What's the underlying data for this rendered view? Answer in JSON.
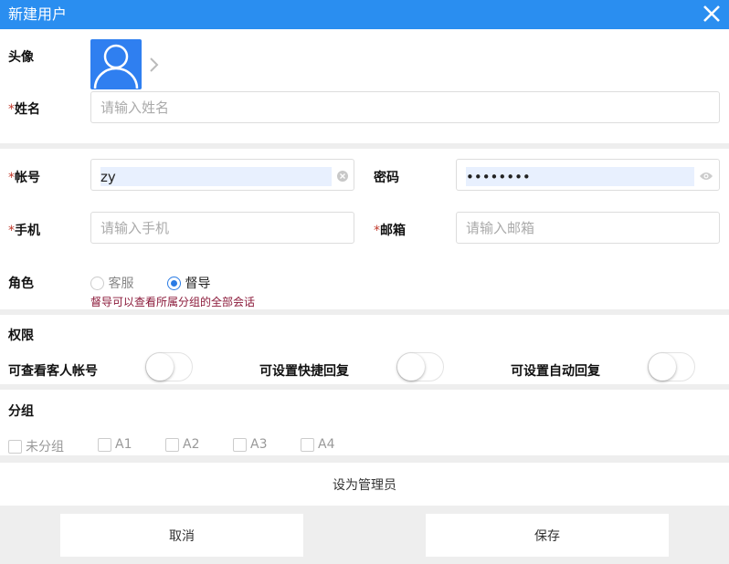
{
  "dialog": {
    "title": "新建用户",
    "close_icon": "close-icon"
  },
  "colors": {
    "header": "#2a8ef0",
    "required": "#c0392b",
    "hint": "#8b1a3a",
    "radio_active": "#2a7be4"
  },
  "form": {
    "avatar": {
      "label": "头像",
      "icon": "user-icon"
    },
    "name": {
      "required": "*",
      "label": "姓名",
      "placeholder": "请输入姓名",
      "value": ""
    },
    "account": {
      "required": "*",
      "label": "帐号",
      "value": "zy"
    },
    "password": {
      "label": "密码",
      "value": "zyzyzyzy"
    },
    "phone": {
      "required": "*",
      "label": "手机",
      "placeholder": "请输入手机",
      "value": ""
    },
    "email": {
      "required": "*",
      "label": "邮箱",
      "placeholder": "请输入邮箱",
      "value": ""
    },
    "role": {
      "label": "角色",
      "options": [
        {
          "label": "客服",
          "selected": false
        },
        {
          "label": "督导",
          "selected": true
        }
      ],
      "hint": "督导可以查看所属分组的全部会话"
    }
  },
  "permissions": {
    "title": "权限",
    "items": [
      {
        "label": "可查看客人帐号",
        "on": false
      },
      {
        "label": "可设置快捷回复",
        "on": false
      },
      {
        "label": "可设置自动回复",
        "on": false
      }
    ]
  },
  "groups": {
    "title": "分组",
    "items": [
      {
        "label": "未分组",
        "checked": false
      },
      {
        "label": "A1",
        "checked": false
      },
      {
        "label": "A2",
        "checked": false
      },
      {
        "label": "A3",
        "checked": false
      },
      {
        "label": "A4",
        "checked": false
      }
    ]
  },
  "footer": {
    "admin": "设为管理员",
    "cancel": "取消",
    "save": "保存"
  }
}
